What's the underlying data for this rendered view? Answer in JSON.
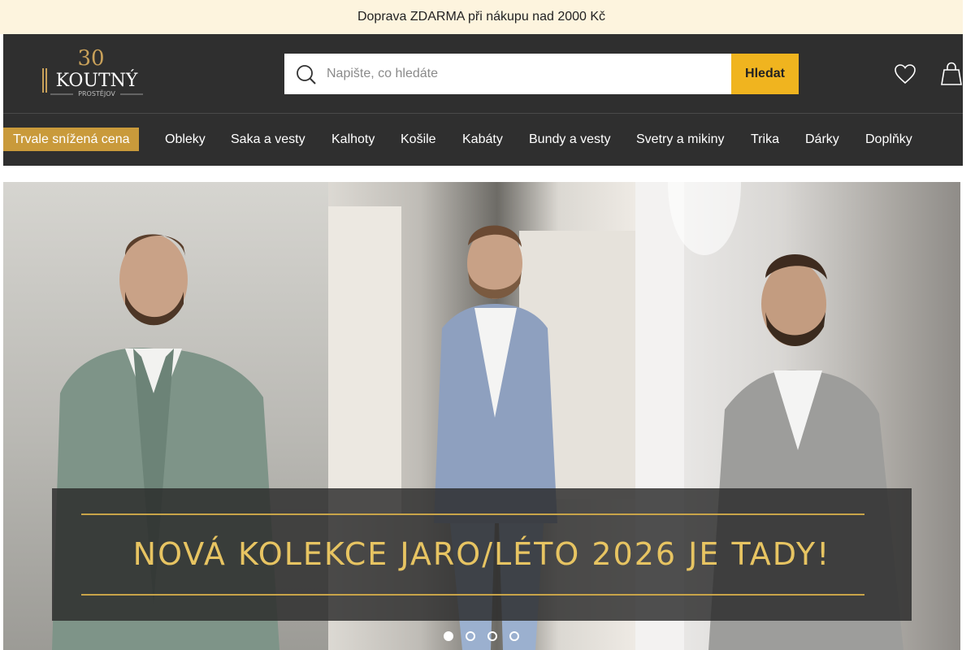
{
  "topbar": {
    "text": "Doprava ZDARMA při nákupu nad 2000 Kč",
    "close_glyph": ""
  },
  "logo": {
    "number": "30",
    "name": "KOUTNÝ",
    "city": "PROSTĚJOV"
  },
  "search": {
    "placeholder": "Napište, co hledáte",
    "value": "",
    "button_label": "Hledat"
  },
  "icons": {
    "search": "search-icon",
    "wishlist": "heart-icon",
    "cart": "shopping-bag-icon",
    "more": "chevron-right-icon"
  },
  "nav": {
    "items": [
      {
        "label": "Trvale snížená cena"
      },
      {
        "label": "Obleky"
      },
      {
        "label": "Saka a vesty"
      },
      {
        "label": "Kalhoty"
      },
      {
        "label": "Košile"
      },
      {
        "label": "Kabáty"
      },
      {
        "label": "Bundy a vesty"
      },
      {
        "label": "Svetry a mikiny"
      },
      {
        "label": "Trika"
      },
      {
        "label": "Dárky"
      },
      {
        "label": "Doplňky"
      }
    ],
    "more_glyph": ""
  },
  "hero": {
    "banner_text": "NOVÁ KOLEKCE JARO/LÉTO 2026 JE TADY!",
    "slides_total": 4,
    "active_slide": 1
  },
  "colors": {
    "topbar_bg": "#fdf4de",
    "header_bg": "#2f2f2f",
    "accent": "#f0b41f",
    "highlight": "#c99a3b",
    "banner_gold": "#e7c462"
  }
}
